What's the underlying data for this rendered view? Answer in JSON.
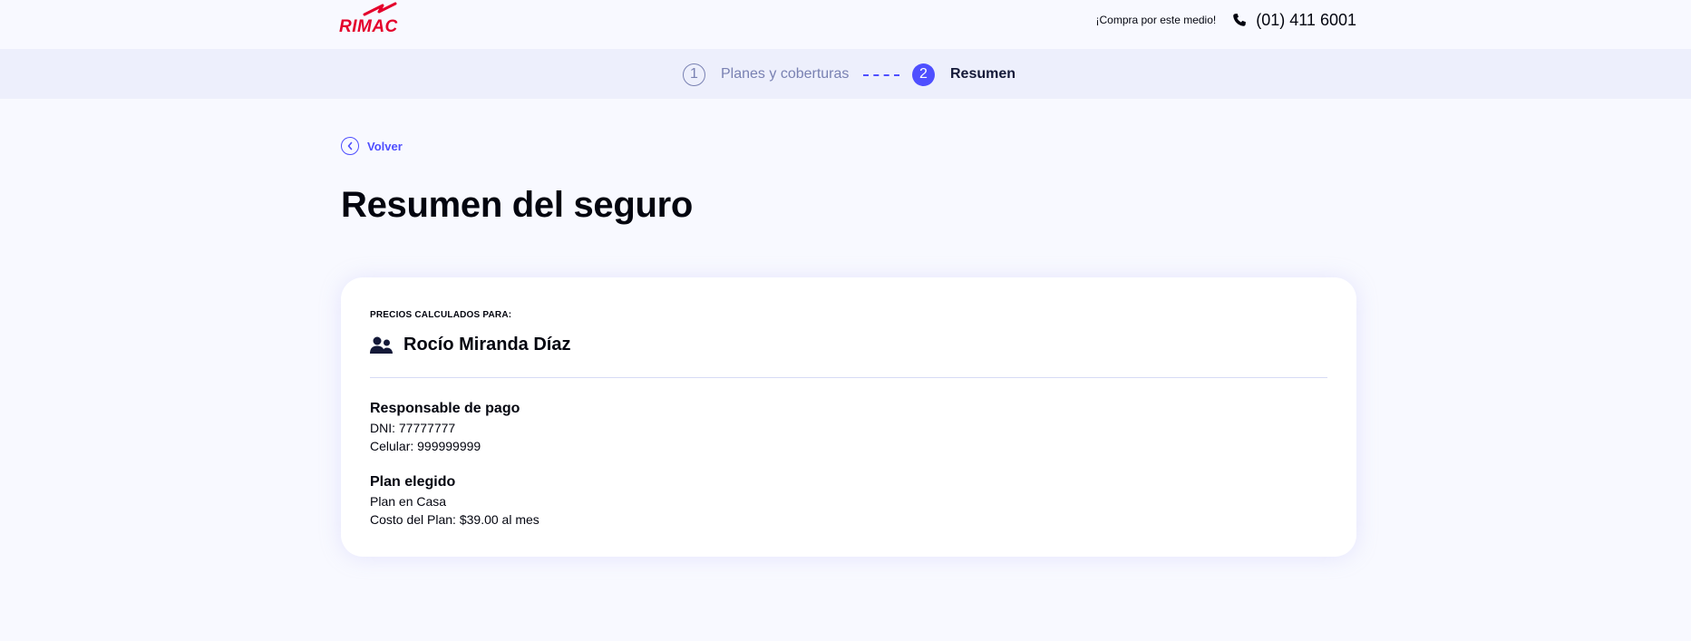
{
  "brand": {
    "logo_text": "RIMAC",
    "logo_color": "#e4002b"
  },
  "header": {
    "promo_text": "¡Compra por este medio!",
    "phone_icon": "phone-icon",
    "phone_number": "(01) 411 6001"
  },
  "stepper": {
    "steps": [
      {
        "number": "1",
        "label": "Planes y coberturas",
        "state": "completed"
      },
      {
        "number": "2",
        "label": "Resumen",
        "state": "active"
      }
    ],
    "active_color": "#4f4fff"
  },
  "back": {
    "icon": "chevron-left-icon",
    "label": "Volver"
  },
  "page": {
    "title": "Resumen del seguro"
  },
  "summary": {
    "caption": "PRECIOS CALCULADOS PARA:",
    "user_icon": "users-icon",
    "user_name": "Rocío Miranda Díaz",
    "payer": {
      "title": "Responsable de pago",
      "dni": "DNI: 77777777",
      "phone": "Celular: 999999999"
    },
    "plan": {
      "title": "Plan elegido",
      "name": "Plan en Casa",
      "cost": "Costo del Plan: $39.00 al mes"
    }
  }
}
